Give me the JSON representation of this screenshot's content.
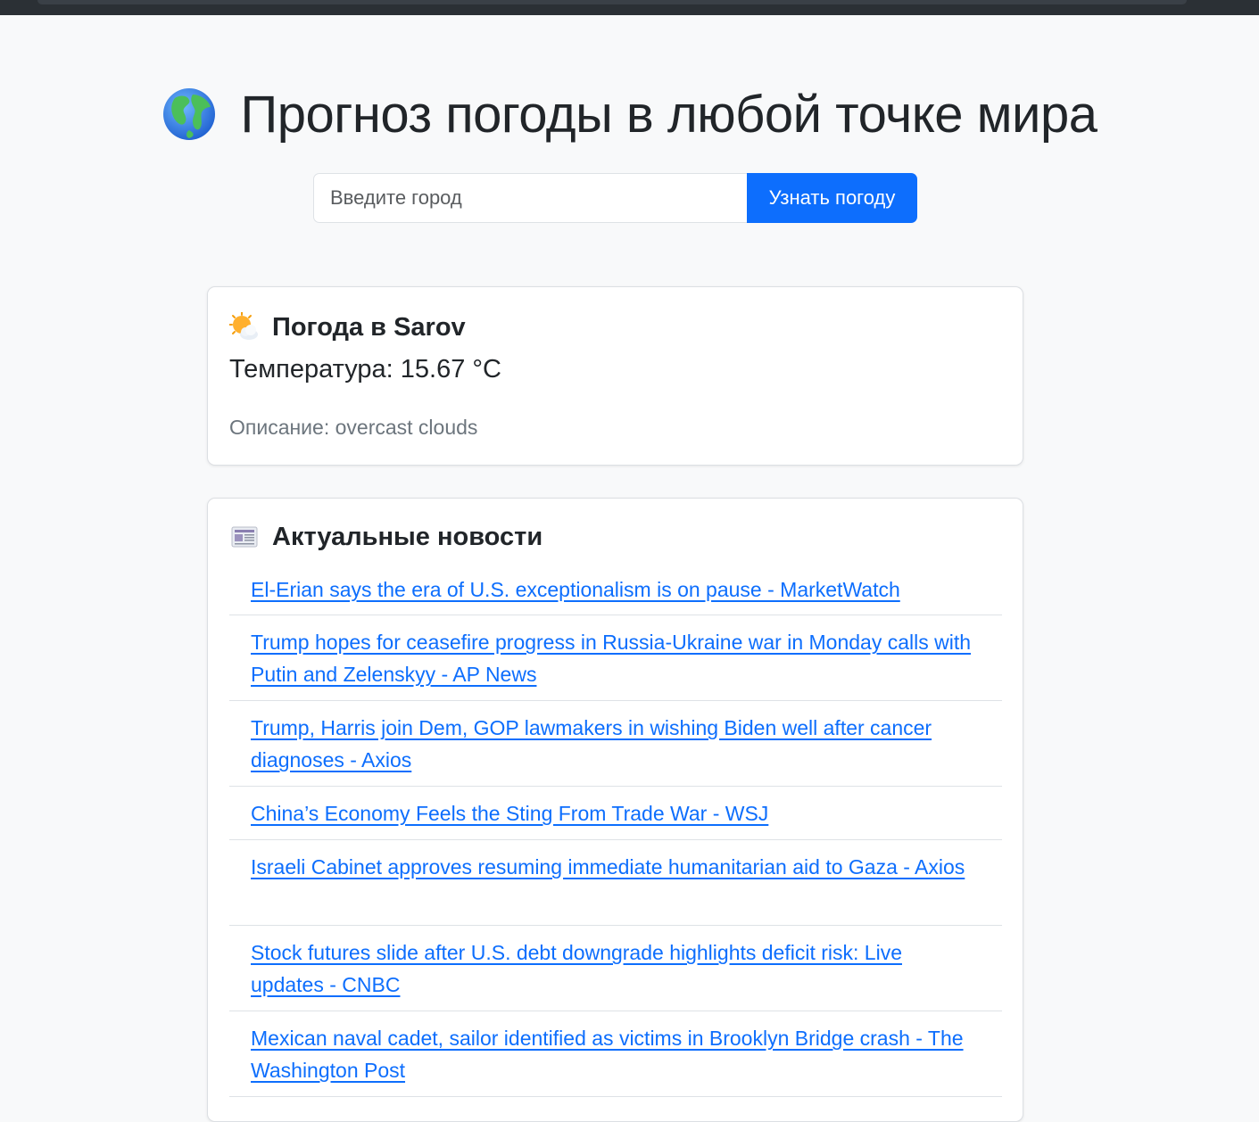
{
  "header": {
    "title": "Прогноз погоды в любой точке мира",
    "icon": "globe-icon"
  },
  "search": {
    "placeholder": "Введите город",
    "value": "",
    "button_label": "Узнать погоду"
  },
  "weather": {
    "icon": "sun-behind-cloud-icon",
    "title": "Погода в Sarov",
    "temperature": "Температура: 15.67 °C",
    "description": "Описание: overcast clouds"
  },
  "news": {
    "icon": "newspaper-icon",
    "title": "Актуальные новости",
    "items": [
      {
        "label": "El-Erian says the era of U.S. exceptionalism is on pause - MarketWatch"
      },
      {
        "label": "Trump hopes for ceasefire progress in Russia-Ukraine war in Monday calls with Putin and Zelenskyy - AP News"
      },
      {
        "label": "Trump, Harris join Dem, GOP lawmakers in wishing Biden well after cancer diagnoses - Axios"
      },
      {
        "label": "China’s Economy Feels the Sting From Trade War - WSJ"
      },
      {
        "label": "Israeli Cabinet approves resuming immediate humanitarian aid to Gaza - Axios"
      },
      {
        "label": "Stock futures slide after U.S. debt downgrade highlights deficit risk: Live updates - CNBC"
      },
      {
        "label": "Mexican naval cadet, sailor identified as victims in Brooklyn Bridge crash - The Washington Post"
      }
    ]
  },
  "colors": {
    "accent": "#0d6efd",
    "background": "#f8f9fa",
    "muted_text": "#6c757d"
  }
}
